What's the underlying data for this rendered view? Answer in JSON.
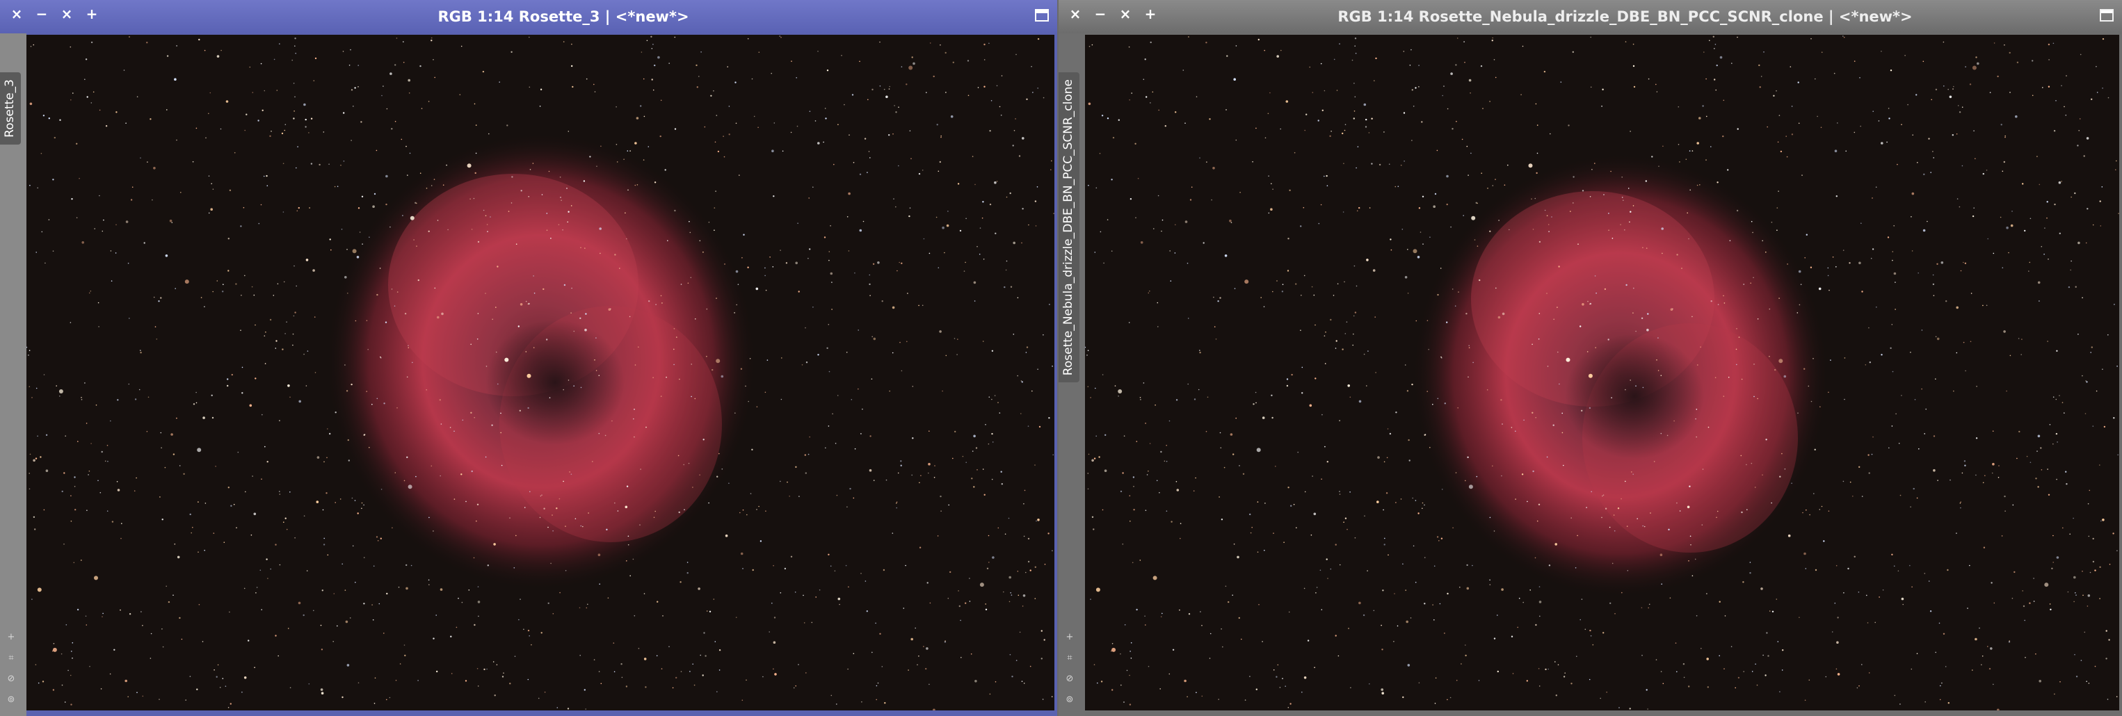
{
  "windows": [
    {
      "title": "RGB 1:14 Rosette_3 | <*new*>",
      "tab_label": "Rosette_3",
      "controls": [
        "×",
        "−",
        "×",
        "+"
      ],
      "active": true
    },
    {
      "title": "RGB 1:14 Rosette_Nebula_drizzle_DBE_BN_PCC_SCNR_clone | <*new*>",
      "tab_label": "Rosette_Nebula_drizzle_DBE_BN_PCC_SCNR_clone",
      "controls": [
        "×",
        "−",
        "×",
        "+"
      ],
      "active": false
    }
  ],
  "side_tools": [
    "+",
    "⌗",
    "⊘",
    "⊚"
  ],
  "colors": {
    "active_titlebar": "#5a62b0",
    "inactive_titlebar": "#6e6e6e",
    "nebula": "#b5374a",
    "sky": "#16100e"
  }
}
